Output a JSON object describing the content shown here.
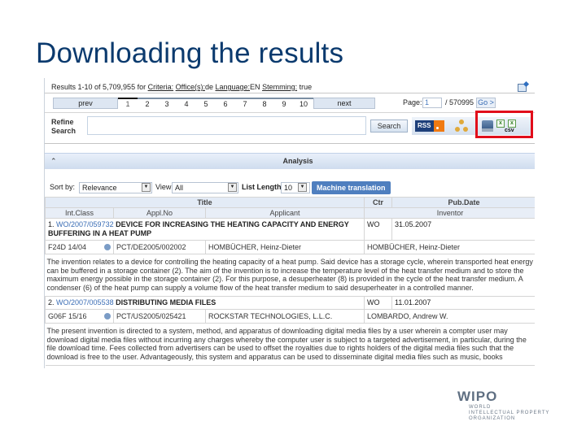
{
  "slide": {
    "title": "Downloading the results"
  },
  "results": {
    "prefix": "Results 1-10 of 5,709,955 for ",
    "criteria": "Criteria:",
    "office": "Office(s):",
    "office_value": "de",
    "language": "Language:",
    "language_value": "EN",
    "stemming": "Stemming:",
    "stemming_value": "true"
  },
  "pager": {
    "prev": "prev",
    "next": "next",
    "pages": [
      "1",
      "2",
      "3",
      "4",
      "5",
      "6",
      "7",
      "8",
      "9",
      "10"
    ],
    "current_page": "1",
    "page_label": "Page:",
    "page_input": "1",
    "page_total": "/ 570995",
    "go": "Go >"
  },
  "refine": {
    "label_line1": "Refine",
    "label_line2": "Search",
    "input_value": "",
    "search_button": "Search"
  },
  "toolbar": {
    "rss": "RSS",
    "icons": [
      "rss-feed-icon",
      "network-analysis-icon",
      "download-icon",
      "excel-icon",
      "excel-csv-icon"
    ],
    "csv_label": "csv"
  },
  "analysis": {
    "label": "Analysis",
    "toggle": "⌃"
  },
  "options": {
    "sort_label": "Sort by:",
    "sort_value": "Relevance",
    "view_label": "View:",
    "view_value": "All",
    "list_length_label": "List Length",
    "list_length_value": "10",
    "machine_translation": "Machine translation"
  },
  "table": {
    "header1": {
      "title": "Title",
      "ctr": "Ctr",
      "pubdate": "Pub.Date"
    },
    "header2": {
      "intclass": "Int.Class",
      "applno": "Appl.No",
      "applicant": "Applicant",
      "inventor": "Inventor"
    },
    "rows": [
      {
        "num": "1.",
        "wo": "WO/2007/059732",
        "title": "DEVICE FOR INCREASING THE HEATING CAPACITY AND ENERGY BUFFERING IN A HEAT PUMP",
        "ctr": "WO",
        "pubdate": "31.05.2007",
        "intclass": "F24D 14/04",
        "applno": "PCT/DE2005/002002",
        "applicant": "HOMBÜCHER, Heinz-Dieter",
        "inventor": "HOMBÜCHER, Heinz-Dieter",
        "abstract": "The invention relates to a device for controlling the heating capacity of a heat pump. Said device has a storage cycle, wherein transported heat energy can be buffered in a storage container (2). The aim of the invention is to increase the temperature level of the heat transfer medium and to store the maximum energy possible in the storage container (2). For this purpose, a desuperheater (8) is provided in the cycle of the heat transfer medium. A condenser (6) of the heat pump can supply a volume flow of the heat transfer medium to said desuperheater in a controlled manner."
      },
      {
        "num": "2.",
        "wo": "WO/2007/005538",
        "title": "DISTRIBUTING MEDIA FILES",
        "ctr": "WO",
        "pubdate": "11.01.2007",
        "intclass": "G06F 15/16",
        "applno": "PCT/US2005/025421",
        "applicant": "ROCKSTAR TECHNOLOGIES, L.L.C.",
        "inventor": "LOMBARDO, Andrew W.",
        "abstract": "The present invention is directed to a system, method, and apparatus of downloading digital media files by a user wherein a compter user may download digital media files without incurring any charges whereby the computer user is subject to a targeted advertisement, in particular, during the file download time. Fees collected from advertisers can be used to offset the royalties due to rights holders of the digital media files such that the download is free to the user. Advantageously, this system and apparatus can be used to disseminate digital media files such as music, books"
      }
    ]
  },
  "logo": {
    "name": "WIPO",
    "line1": "WORLD",
    "line2": "INTELLECTUAL PROPERTY",
    "line3": "ORGANIZATION"
  },
  "colors": {
    "title": "#0b3a6e",
    "highlight": "#e10d1a",
    "link": "#3a6db5",
    "header_bg": "#e3ebf6",
    "button": "#4f7fbf"
  }
}
